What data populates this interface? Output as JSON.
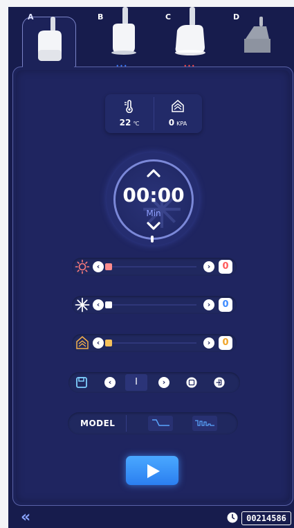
{
  "tabs": [
    {
      "letter": "A",
      "dots": "",
      "active": true
    },
    {
      "letter": "B",
      "dots": "•••",
      "dot_color": "#3d7cff"
    },
    {
      "letter": "C",
      "dots": "•••",
      "dot_color": "#ff4a4a"
    },
    {
      "letter": "D",
      "dots": ""
    }
  ],
  "readout": {
    "temperature_value": "22",
    "temperature_unit": "℃",
    "pressure_value": "0",
    "pressure_unit": "KPA"
  },
  "timer": {
    "time": "00:00",
    "unit": "Min",
    "up_icon": "chevron-up-icon",
    "down_icon": "chevron-down-icon"
  },
  "sliders": [
    {
      "name": "heat",
      "icon": "sun-icon",
      "value": "0",
      "level": 0,
      "accent": "#ff6b6b"
    },
    {
      "name": "cold",
      "icon": "snowflake-icon",
      "value": "0",
      "level": 0,
      "accent": "#5aa6ff"
    },
    {
      "name": "vacuum",
      "icon": "vacuum-icon",
      "value": "0",
      "level": 0,
      "accent": "#f5b04a"
    }
  ],
  "preset": {
    "number": "I",
    "icons": [
      "save-icon",
      "chevron-left-icon",
      "chevron-right-icon",
      "save-small-icon",
      "export-icon"
    ]
  },
  "model": {
    "label": "MODEL",
    "options": [
      "step-wave-icon",
      "pulse-wave-icon"
    ]
  },
  "play": {
    "icon": "play-icon"
  },
  "footer": {
    "back_icon": "«",
    "serial": "00214586",
    "clock_icon": "clock-icon"
  },
  "colors": {
    "background": "#171c4d",
    "panel": "#1f2560",
    "accent_blue": "#2b7ff0",
    "heat": "#ff6b6b",
    "cold": "#5aa6ff",
    "vacuum": "#f5b04a"
  }
}
